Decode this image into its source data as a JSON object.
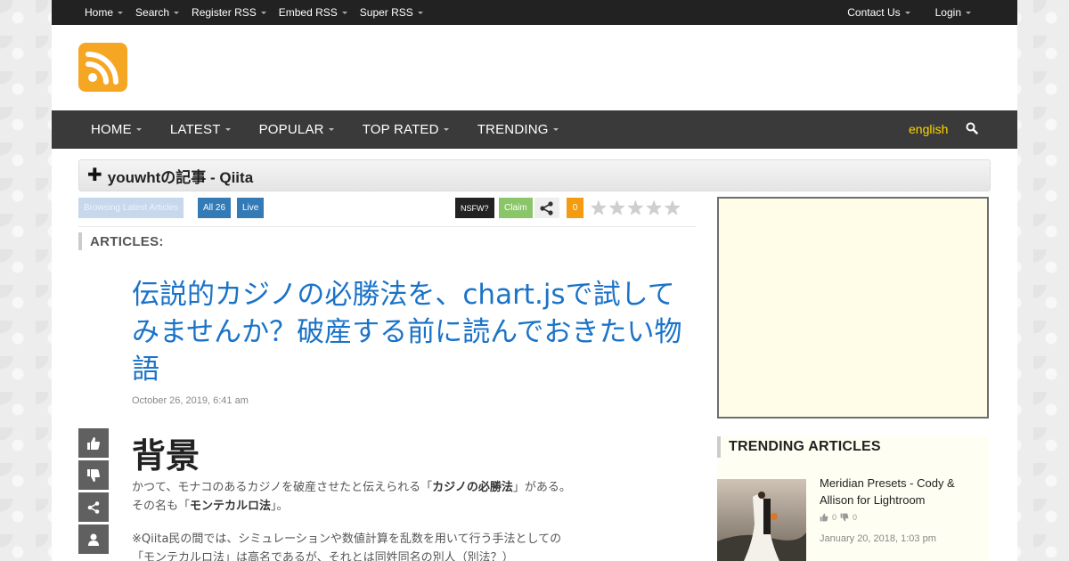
{
  "topnav": {
    "items": [
      "Home",
      "Search",
      "Register RSS",
      "Embed RSS",
      "Super RSS"
    ],
    "contact": "Contact Us",
    "login": "Login"
  },
  "mainnav": {
    "items": [
      "HOME",
      "LATEST",
      "POPULAR",
      "TOP RATED",
      "TRENDING"
    ],
    "language": "english"
  },
  "feed": {
    "plus": "✚",
    "title": "youwhtの記事 - Qiita"
  },
  "toolbar": {
    "browsing": "Browsing Latest Articles",
    "all": "All 26",
    "live": "Live",
    "nsfw": "NSFW?",
    "claim": "Claim",
    "count": "0",
    "rating_stars": 5
  },
  "articles_label": "ARTICLES:",
  "article": {
    "title": "伝説的カジノの必勝法を、chart.jsで試してみませんか？破産する前に読んでおきたい物語",
    "date": "October 26, 2019, 6:41 am",
    "heading": "背景",
    "p1_a": "かつて、モナコのあるカジノを破産させたと伝えられる「",
    "p1_b": "カジノの必勝法",
    "p1_c": "」がある。",
    "p2_a": "その名も「",
    "p2_b": "モンテカルロ法",
    "p2_c": "」。",
    "p3_line1": "※Qiita民の間では、シミュレーションや数値計算を乱数を用いて行う手法としての",
    "p3_line2": "「モンテカルロ法」は高名であるが、それとは同姓同名の別人（別法？）"
  },
  "trending": {
    "heading": "TRENDING ARTICLES",
    "item": {
      "title": "Meridian Presets - Cody & Allison for Lightroom",
      "up": "0",
      "down": "0",
      "date": "January 20, 2018, 1:03 pm"
    }
  },
  "colors": {
    "accent_blue": "#337ab7",
    "link_blue": "#1a73c8",
    "rss_orange": "#f5a623",
    "claim_green": "#8bc56a",
    "count_orange": "#f39c12",
    "language_yellow": "#ffd700"
  },
  "icons": [
    "rss-icon",
    "search-icon",
    "share-icon",
    "thumbs-up-icon",
    "thumbs-down-icon",
    "user-icon",
    "star-icon"
  ]
}
